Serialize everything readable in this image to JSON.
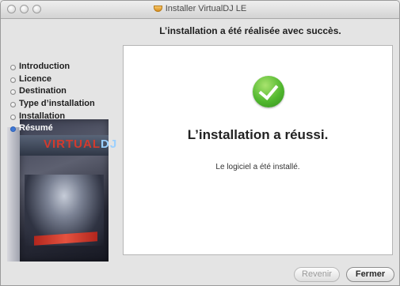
{
  "window": {
    "title": "Installer VirtualDJ LE",
    "heading": "L’installation a été réalisée avec succès."
  },
  "sidebar": {
    "steps": [
      {
        "label": "Introduction",
        "current": false
      },
      {
        "label": "Licence",
        "current": false
      },
      {
        "label": "Destination",
        "current": false
      },
      {
        "label": "Type d’installation",
        "current": false
      },
      {
        "label": "Installation",
        "current": false
      },
      {
        "label": "Résumé",
        "current": true
      }
    ],
    "box_logo_text": "VIRTUAL",
    "box_logo_text2": "DJ"
  },
  "content": {
    "success_title": "L’installation a réussi.",
    "success_detail": "Le logiciel a été installé."
  },
  "buttons": {
    "back_label": "Revenir",
    "close_label": "Fermer"
  },
  "colors": {
    "accent": "#3e78d6",
    "check_green": "#52b82f"
  }
}
